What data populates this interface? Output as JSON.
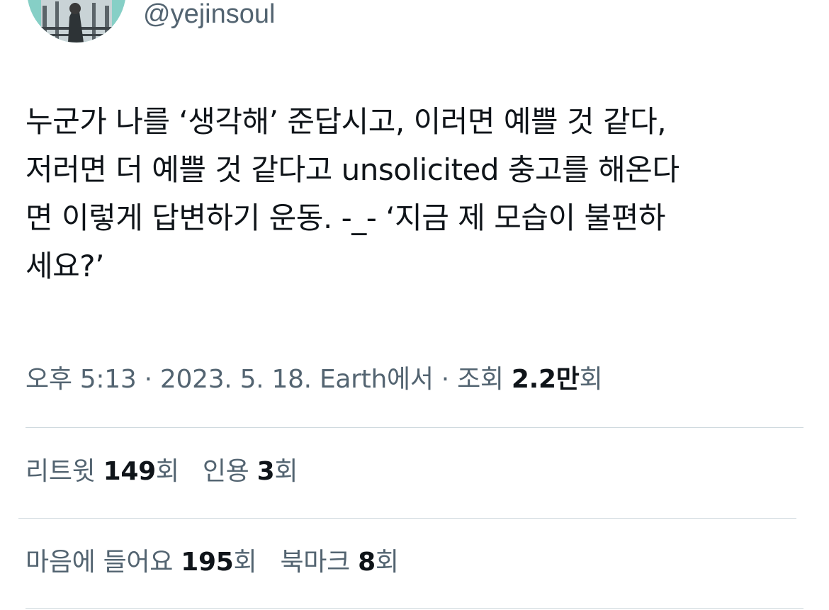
{
  "user": {
    "handle": "@yejinsoul"
  },
  "tweet": {
    "text": "누군가 나를 ‘생각해’ 준답시고, 이러면 예쁠 것 같다,\n저러면 더 예쁠 것 같다고 unsolicited 충고를 해온다\n면 이렇게 답변하기 운동. -_- ‘지금 제 모습이 불편하\n세요?’"
  },
  "meta": {
    "time": "오후 5:13",
    "sep1": " · ",
    "date": "2023. 5. 18.",
    "source": " Earth에서",
    "sep2": " · ",
    "views_label": "조회 ",
    "views_value": "2.2만",
    "views_suffix": "회"
  },
  "stats": {
    "retweets_label": "리트윗 ",
    "retweets_value": "149",
    "retweets_suffix": "회",
    "quotes_label": "인용 ",
    "quotes_value": "3",
    "quotes_suffix": "회",
    "likes_label": "마음에 들어요 ",
    "likes_value": "195",
    "likes_suffix": "회",
    "bookmarks_label": "북마크 ",
    "bookmarks_value": "8",
    "bookmarks_suffix": "회"
  },
  "colors": {
    "text_primary": "#0f1419",
    "text_secondary": "#536471",
    "divider": "#cfd9de",
    "avatar_bg": "#86cfc6"
  }
}
